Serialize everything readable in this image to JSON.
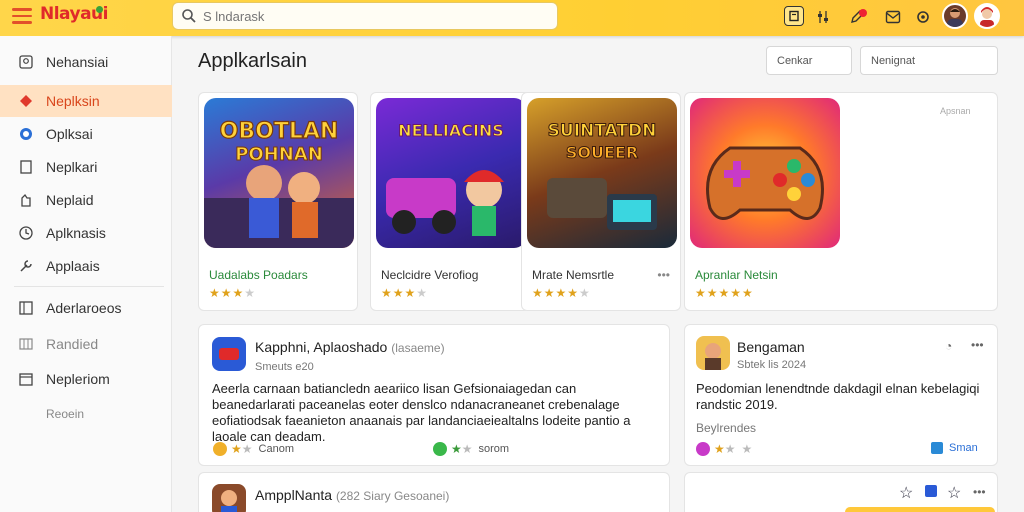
{
  "topbar": {
    "logo": "Nlayaui",
    "search_placeholder": "S lndarask"
  },
  "sidebar": {
    "items": [
      {
        "label": "Nehansiai",
        "icon": "users-icon"
      },
      {
        "label": "Neplksin",
        "icon": "tag-icon",
        "active": true
      },
      {
        "label": "Oplksai",
        "icon": "circle-o-icon"
      },
      {
        "label": "Neplkari",
        "icon": "page-icon"
      },
      {
        "label": "Neplaid",
        "icon": "hand-icon"
      },
      {
        "label": "Aplknasis",
        "icon": "clock-icon"
      },
      {
        "label": "Applaais",
        "icon": "wrench-icon"
      },
      {
        "label": "Aderlaroeos",
        "icon": "table-icon"
      },
      {
        "label": "Randied",
        "icon": "grid-icon"
      },
      {
        "label": "Nepleriom",
        "icon": "calendar-icon"
      },
      {
        "label": "Reoein"
      }
    ]
  },
  "main": {
    "title": "Applkarlsain",
    "filter_left": "Cenkar",
    "filter_right": "Nenignat",
    "featured_hint": "Apsnan",
    "featured": [
      {
        "name": "Uadalabs Poadars",
        "stars": 3,
        "art_text": "OBOTLAN\nPOHNAN"
      },
      {
        "name": "Neclcidre Verofiog",
        "stars": 3,
        "art_text": "NELLIACINS"
      },
      {
        "name": "Mrate Nemsrtle",
        "stars": 4,
        "art_text": "SUINTATDN\nSOUEER"
      },
      {
        "name": "Apranlar Netsin",
        "stars": 5,
        "art_text": ""
      }
    ],
    "post1": {
      "title": "Kapphni, Aplaoshado",
      "sub": "(lasaeme)",
      "meta": "Smeuts e20",
      "body": "Aeerla carnaan batiancledn aeariico lisan Gefsionaiagedan can beanedarlarati paceanelas eoter denslco ndanacraneanet crebenalage eofiatiodsak faeanieton anaanais par landanciaeiealtalns lodeite pantio a laoale can deadam.",
      "foot_left": "Canom",
      "foot_right": "sorom"
    },
    "post2": {
      "title": "Bengaman",
      "meta": "Sbtek lis 2024",
      "body": "Peodomian lenendtnde dakdagil elnan kebelagiqi randstic 2019.",
      "sub": "Beylrendes",
      "foot_right": "Sman"
    },
    "post3": {
      "title": "AmpplNanta",
      "sub": "(282 Siary Gesoanei)"
    }
  }
}
